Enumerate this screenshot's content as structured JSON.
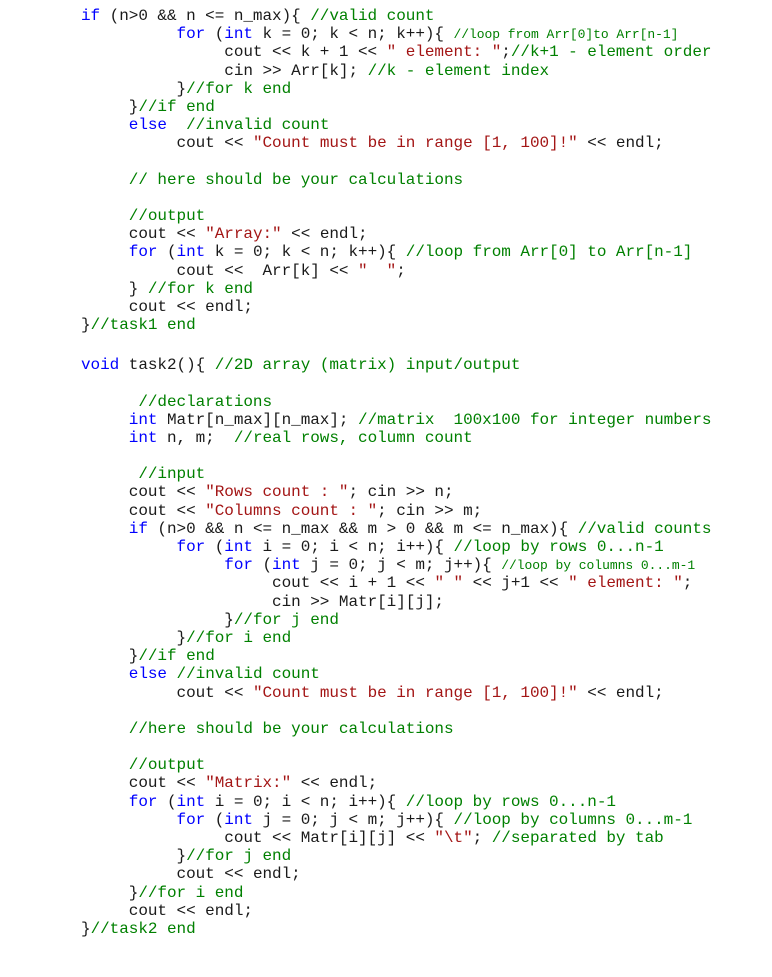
{
  "document": {
    "language": "C++",
    "colors": {
      "keyword": "#0000ff",
      "string": "#a31515",
      "comment": "#008000",
      "plain": "#1a1a1a",
      "background": "#ffffff"
    },
    "lines": [
      {
        "indent": 0,
        "tokens": [
          [
            "kw",
            "if"
          ],
          [
            "pl",
            " (n>0 && n <= n_max){ "
          ],
          [
            "cm",
            "//valid count"
          ]
        ]
      },
      {
        "indent": 10,
        "tokens": [
          [
            "kw",
            "for"
          ],
          [
            "pl",
            " ("
          ],
          [
            "kw",
            "int"
          ],
          [
            "pl",
            " k = 0; k < n; k++){ "
          ],
          [
            "cms",
            "//loop from Arr[0]to Arr[n-1]"
          ]
        ]
      },
      {
        "indent": 15,
        "tokens": [
          [
            "pl",
            "cout << k + 1 << "
          ],
          [
            "str",
            "\" element: \""
          ],
          [
            "pl",
            ";"
          ],
          [
            "cm",
            "//k+1 - element order"
          ]
        ]
      },
      {
        "indent": 15,
        "tokens": [
          [
            "pl",
            "cin >> Arr[k]; "
          ],
          [
            "cm",
            "//k - element index"
          ]
        ]
      },
      {
        "indent": 10,
        "tokens": [
          [
            "pl",
            "}"
          ],
          [
            "cm",
            "//for k end"
          ]
        ]
      },
      {
        "indent": 5,
        "tokens": [
          [
            "pl",
            "}"
          ],
          [
            "cm",
            "//if end"
          ]
        ]
      },
      {
        "indent": 5,
        "tokens": [
          [
            "kw",
            "else"
          ],
          [
            "pl",
            "  "
          ],
          [
            "cm",
            "//invalid count"
          ]
        ]
      },
      {
        "indent": 10,
        "tokens": [
          [
            "pl",
            "cout << "
          ],
          [
            "str",
            "\"Count must be in range [1, 100]!\""
          ],
          [
            "pl",
            " << endl;"
          ]
        ]
      },
      {
        "indent": 0,
        "tokens": []
      },
      {
        "indent": 5,
        "tokens": [
          [
            "cm",
            "// here should be your calculations"
          ]
        ]
      },
      {
        "indent": 0,
        "tokens": []
      },
      {
        "indent": 5,
        "tokens": [
          [
            "cm",
            "//output"
          ]
        ]
      },
      {
        "indent": 5,
        "tokens": [
          [
            "pl",
            "cout << "
          ],
          [
            "str",
            "\"Array:\""
          ],
          [
            "pl",
            " << endl;"
          ]
        ]
      },
      {
        "indent": 5,
        "tokens": [
          [
            "kw",
            "for"
          ],
          [
            "pl",
            " ("
          ],
          [
            "kw",
            "int"
          ],
          [
            "pl",
            " k = 0; k < n; k++){ "
          ],
          [
            "cm",
            "//loop from Arr[0] to Arr[n-1]"
          ]
        ]
      },
      {
        "indent": 10,
        "tokens": [
          [
            "pl",
            "cout <<  Arr[k] << "
          ],
          [
            "str",
            "\"  \""
          ],
          [
            "pl",
            ";"
          ]
        ]
      },
      {
        "indent": 5,
        "tokens": [
          [
            "pl",
            "} "
          ],
          [
            "cm",
            "//for k end"
          ]
        ]
      },
      {
        "indent": 5,
        "tokens": [
          [
            "pl",
            "cout << endl;"
          ]
        ]
      },
      {
        "indent": 0,
        "tokens": [
          [
            "pl",
            "}"
          ],
          [
            "cm",
            "//task1 end"
          ]
        ]
      },
      {
        "indent": 0,
        "tokens": []
      },
      {
        "indent": 0,
        "gap": true,
        "tokens": [
          [
            "kw",
            "void"
          ],
          [
            "pl",
            " task2(){ "
          ],
          [
            "cm",
            "//2D array (matrix) input/output"
          ]
        ]
      },
      {
        "indent": 0,
        "tokens": []
      },
      {
        "indent": 6,
        "tokens": [
          [
            "cm",
            "//declarations"
          ]
        ]
      },
      {
        "indent": 5,
        "tokens": [
          [
            "kw",
            "int"
          ],
          [
            "pl",
            " Matr[n_max][n_max]; "
          ],
          [
            "cm",
            "//matrix  100x100 for integer numbers"
          ]
        ]
      },
      {
        "indent": 5,
        "tokens": [
          [
            "kw",
            "int"
          ],
          [
            "pl",
            " n, m;  "
          ],
          [
            "cm",
            "//real rows, column count"
          ]
        ]
      },
      {
        "indent": 0,
        "tokens": []
      },
      {
        "indent": 6,
        "tokens": [
          [
            "cm",
            "//input"
          ]
        ]
      },
      {
        "indent": 5,
        "tokens": [
          [
            "pl",
            "cout << "
          ],
          [
            "str",
            "\"Rows count : \""
          ],
          [
            "pl",
            "; cin >> n;"
          ]
        ]
      },
      {
        "indent": 5,
        "tokens": [
          [
            "pl",
            "cout << "
          ],
          [
            "str",
            "\"Columns count : \""
          ],
          [
            "pl",
            "; cin >> m;"
          ]
        ]
      },
      {
        "indent": 5,
        "tokens": [
          [
            "kw",
            "if"
          ],
          [
            "pl",
            " (n>0 && n <= n_max && m > 0 && m <= n_max){ "
          ],
          [
            "cm",
            "//valid counts"
          ]
        ]
      },
      {
        "indent": 10,
        "tokens": [
          [
            "kw",
            "for"
          ],
          [
            "pl",
            " ("
          ],
          [
            "kw",
            "int"
          ],
          [
            "pl",
            " i = 0; i < n; i++){ "
          ],
          [
            "cm",
            "//loop by rows 0...n-1"
          ]
        ]
      },
      {
        "indent": 15,
        "tokens": [
          [
            "kw",
            "for"
          ],
          [
            "pl",
            " ("
          ],
          [
            "kw",
            "int"
          ],
          [
            "pl",
            " j = 0; j < m; j++){ "
          ],
          [
            "cms",
            "//loop by columns 0...m-1"
          ]
        ]
      },
      {
        "indent": 20,
        "tokens": [
          [
            "pl",
            "cout << i + 1 << "
          ],
          [
            "str",
            "\" \""
          ],
          [
            "pl",
            " << j+1 << "
          ],
          [
            "str",
            "\" element: \""
          ],
          [
            "pl",
            ";"
          ]
        ]
      },
      {
        "indent": 20,
        "tokens": [
          [
            "pl",
            "cin >> Matr[i][j];"
          ]
        ]
      },
      {
        "indent": 15,
        "tokens": [
          [
            "pl",
            "}"
          ],
          [
            "cm",
            "//for j end"
          ]
        ]
      },
      {
        "indent": 10,
        "tokens": [
          [
            "pl",
            "}"
          ],
          [
            "cm",
            "//for i end"
          ]
        ]
      },
      {
        "indent": 5,
        "tokens": [
          [
            "pl",
            "}"
          ],
          [
            "cm",
            "//if end"
          ]
        ]
      },
      {
        "indent": 5,
        "tokens": [
          [
            "kw",
            "else"
          ],
          [
            "pl",
            " "
          ],
          [
            "cm",
            "//invalid count"
          ]
        ]
      },
      {
        "indent": 10,
        "tokens": [
          [
            "pl",
            "cout << "
          ],
          [
            "str",
            "\"Count must be in range [1, 100]!\""
          ],
          [
            "pl",
            " << endl;"
          ]
        ]
      },
      {
        "indent": 0,
        "tokens": []
      },
      {
        "indent": 5,
        "tokens": [
          [
            "cm",
            "//here should be your calculations"
          ]
        ]
      },
      {
        "indent": 0,
        "tokens": []
      },
      {
        "indent": 5,
        "tokens": [
          [
            "cm",
            "//output"
          ]
        ]
      },
      {
        "indent": 5,
        "tokens": [
          [
            "pl",
            "cout << "
          ],
          [
            "str",
            "\"Matrix:\""
          ],
          [
            "pl",
            " << endl;"
          ]
        ]
      },
      {
        "indent": 5,
        "tokens": [
          [
            "kw",
            "for"
          ],
          [
            "pl",
            " ("
          ],
          [
            "kw",
            "int"
          ],
          [
            "pl",
            " i = 0; i < n; i++){ "
          ],
          [
            "cm",
            "//loop by rows 0...n-1"
          ]
        ]
      },
      {
        "indent": 10,
        "tokens": [
          [
            "kw",
            "for"
          ],
          [
            "pl",
            " ("
          ],
          [
            "kw",
            "int"
          ],
          [
            "pl",
            " j = 0; j < m; j++){ "
          ],
          [
            "cm",
            "//loop by columns 0...m-1"
          ]
        ]
      },
      {
        "indent": 15,
        "tokens": [
          [
            "pl",
            "cout << Matr[i][j] << "
          ],
          [
            "str",
            "\"\\t\""
          ],
          [
            "pl",
            "; "
          ],
          [
            "cm",
            "//separated by tab"
          ]
        ]
      },
      {
        "indent": 10,
        "tokens": [
          [
            "pl",
            "}"
          ],
          [
            "cm",
            "//for j end"
          ]
        ]
      },
      {
        "indent": 10,
        "tokens": [
          [
            "pl",
            "cout << endl;"
          ]
        ]
      },
      {
        "indent": 5,
        "tokens": [
          [
            "pl",
            "}"
          ],
          [
            "cm",
            "//for i end"
          ]
        ]
      },
      {
        "indent": 5,
        "tokens": [
          [
            "pl",
            "cout << endl;"
          ]
        ]
      },
      {
        "indent": 0,
        "tokens": [
          [
            "pl",
            "}"
          ],
          [
            "cm",
            "//task2 end"
          ]
        ]
      }
    ]
  }
}
